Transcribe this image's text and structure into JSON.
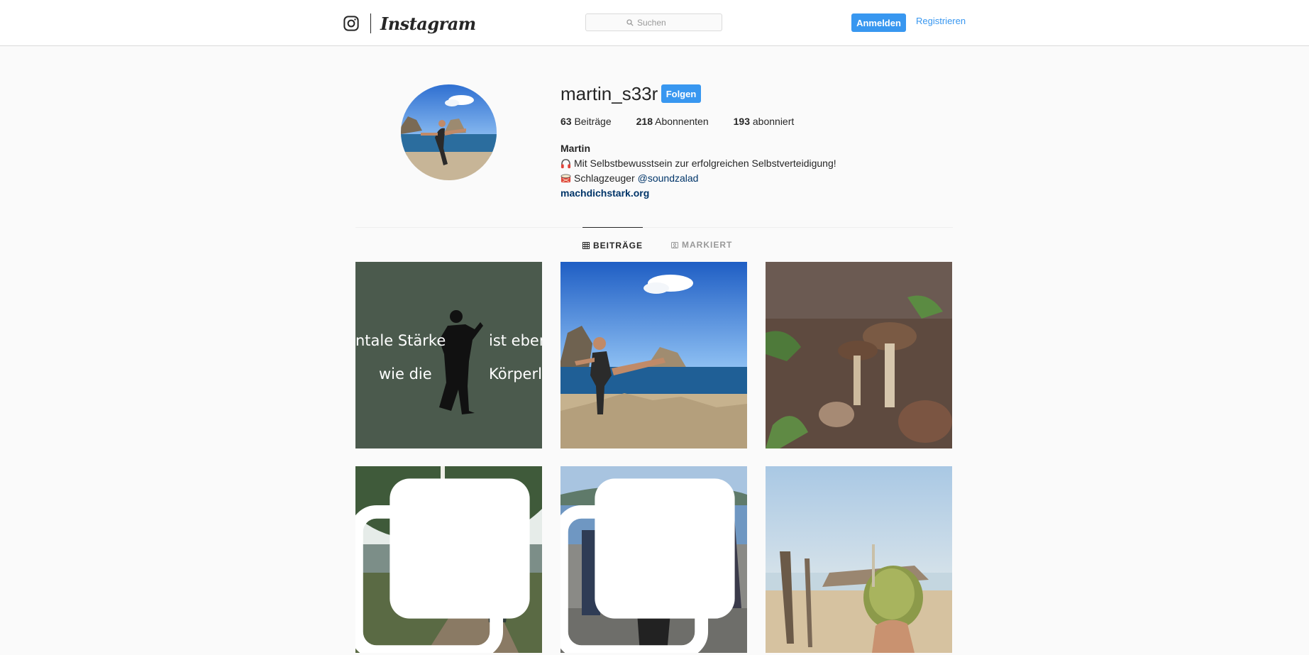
{
  "nav": {
    "logo_wordmark": "Instagram",
    "search_placeholder": "Suchen",
    "login_label": "Anmelden",
    "register_label": "Registrieren"
  },
  "profile": {
    "username": "martin_s33r",
    "follow_label": "Folgen",
    "stats": {
      "posts_count": "63",
      "posts_label": "Beiträge",
      "followers_count": "218",
      "followers_label": "Abonnenten",
      "following_count": "193",
      "following_label": "abonniert"
    },
    "bio": {
      "name": "Martin",
      "line1": "Mit Selbstbewusstsein zur erfolgreichen Selbstverteidigung!",
      "line2_text": "Schlagzeuger",
      "line2_mention": "@soundzalad",
      "link": "machdichstark.org"
    }
  },
  "tabs": [
    {
      "label": "BEITRÄGE",
      "active": true
    },
    {
      "label": "MARKIERT",
      "active": false
    }
  ],
  "posts": [
    {
      "overlay_text": [
        "ntale Stärke",
        "ist ebens",
        "wie die",
        "Körperlic"
      ],
      "multi": false
    },
    {
      "overlay_text": [],
      "multi": false
    },
    {
      "overlay_text": [],
      "multi": false
    },
    {
      "overlay_text": [],
      "multi": true
    },
    {
      "overlay_text": [],
      "multi": true
    },
    {
      "overlay_text": [],
      "multi": false
    }
  ],
  "colors": {
    "accent": "#3897f0",
    "link_dark": "#003569",
    "text": "#262626",
    "muted": "#999999",
    "background": "#fafafa",
    "border": "#dbdbdb"
  },
  "icons": {
    "logo": "instagram-glyph-icon",
    "search": "search-icon",
    "bio_line1": "headphones-emoji-icon",
    "bio_line2": "drum-emoji-icon",
    "tab_posts": "grid-icon",
    "tab_tagged": "tagged-icon",
    "multi_post": "multi-post-icon"
  }
}
